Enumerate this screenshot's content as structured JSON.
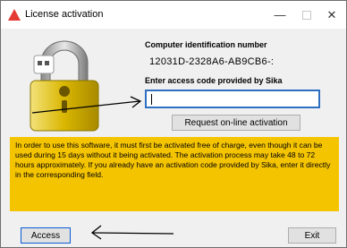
{
  "window": {
    "title": "License activation",
    "controls": {
      "minimize": "—",
      "close": "✕"
    }
  },
  "labels": {
    "computer_id": "Computer identification number",
    "access_code": "Enter access code provided by Sika"
  },
  "computer_id_value": "12031D-2328A6-AB9CB6-:",
  "access_code_input": {
    "value": "",
    "placeholder": ""
  },
  "buttons": {
    "online_activation": "Request on-line activation",
    "access": "Access",
    "exit": "Exit"
  },
  "info_text": "In order to use this software, it must first be activated free of charge, even though it can be used during 15 days without it being activated. The activation process may take 48 to 72 hours approximately. If you already have an activation code provided by Sika, enter it directly in the corresponding field.",
  "colors": {
    "info_background": "#f5c400",
    "input_border": "#2f6fc1",
    "lock_gold": "#d9b600",
    "app_icon_red": "#e53935"
  }
}
